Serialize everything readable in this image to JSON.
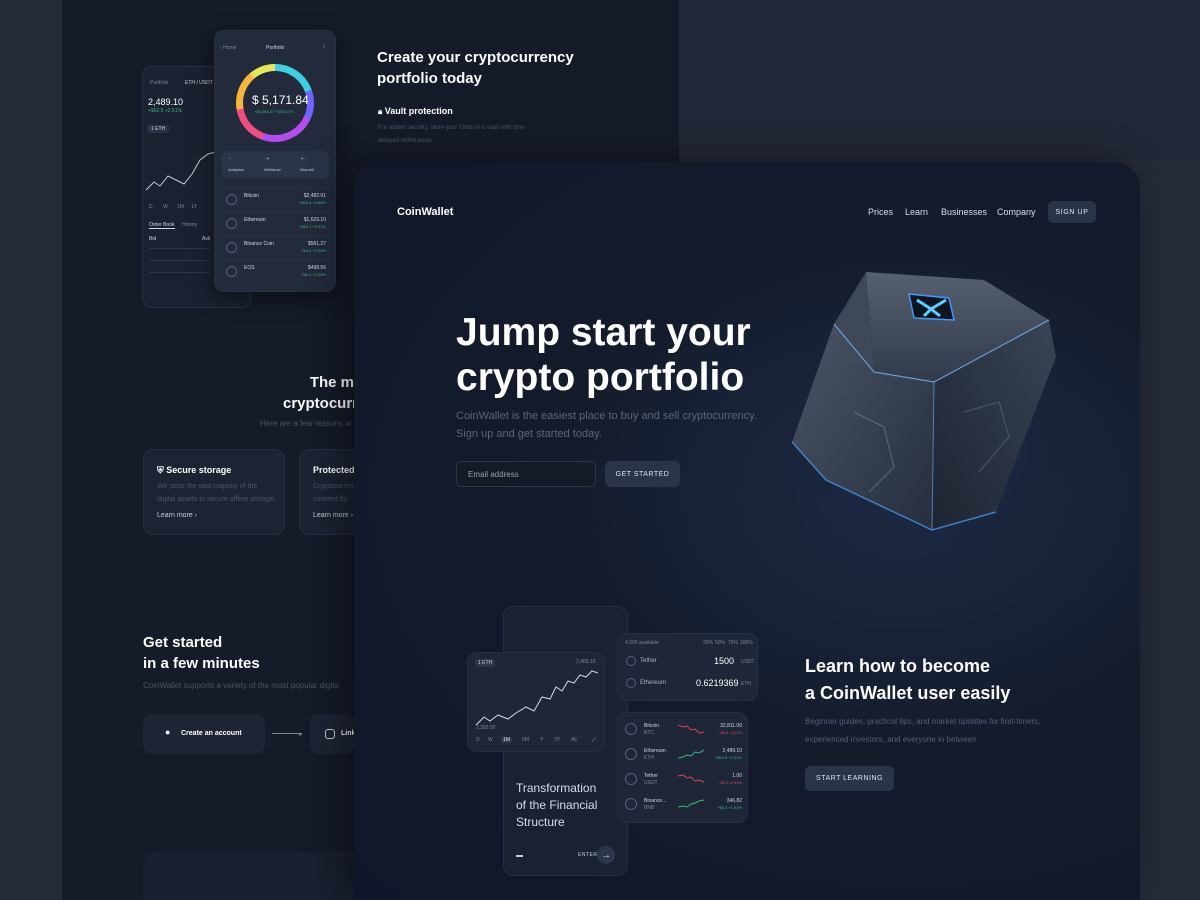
{
  "back": {
    "phone_back": {
      "nav": "Portfolio",
      "pair": "ETH / USDT",
      "price": "2,489.10",
      "change": "+$62.5  +2.51%",
      "badge": "1 ETH",
      "timeframes": [
        "D",
        "W",
        "1M",
        "1Y",
        "All"
      ],
      "tabs": [
        "Order Book",
        "History",
        "Info"
      ],
      "col_bid": "Bid",
      "col_ask": "Ask"
    },
    "phone_front": {
      "home": "Home",
      "title": "Portfolio",
      "balance": "$ 5,171.84",
      "balance_change": "+$3,384.37  +653.67%",
      "actions": [
        "Analytics",
        "Withdraw",
        "Deposit"
      ],
      "coins": [
        {
          "name": "Bitcoin",
          "ticker": "0.0457 BTC",
          "value": "$2,482.91",
          "change": "+$23.6  +3.86%"
        },
        {
          "name": "Ethereum",
          "ticker": "0.6219 ETH",
          "value": "$1,629.10",
          "change": "+$16.1  +3.31%"
        },
        {
          "name": "Binance Coin",
          "ticker": "1.51 BNB",
          "value": "$561.27",
          "change": "+$4.6  +3.06%"
        },
        {
          "name": "EOS",
          "ticker": "127.4 EOS",
          "value": "$498.56",
          "change": "+$1.4  +2.36%"
        }
      ]
    },
    "create_title_line1": "Create your cryptocurrency",
    "create_title_line2": "portfolio today",
    "vault_title": "Vault protection",
    "vault_text_line1": "For added security, store your funds in a vault with time",
    "vault_text_line2": "delayed withdrawals.",
    "most_title_line1": "The m",
    "most_title_line2": "cryptocurr",
    "most_sub": "Here are a few reasons w",
    "features": [
      {
        "title": "Secure storage",
        "text": "We store the vast majority of the digital assets in secure offline storage.",
        "link": "Learn more"
      },
      {
        "title": "Protected",
        "text": "Cryptocurren is covered by",
        "link": "Learn more"
      }
    ],
    "started_title_line1": "Get started",
    "started_title_line2": "in a few minutes",
    "started_sub": "CoinWallet supports a variety of the most popular digita",
    "step1": "Create an account",
    "step2": "Link"
  },
  "front": {
    "brand": "CoinWallet",
    "nav": [
      "Prices",
      "Learn",
      "Businesses",
      "Company"
    ],
    "signup": "SIGN UP",
    "hero_line1": "Jump start your",
    "hero_line2": "crypto portfolio",
    "hero_sub": "CoinWallet is the easiest place to buy and sell cryptocurrency. Sign up and get started today.",
    "email_placeholder": "Email address",
    "cta": "GET STARTED",
    "learn_line1": "Learn how to become",
    "learn_line2": "a CoinWallet user easily",
    "learn_sub": "Beginner guides, practical tips, and market updates for first-timers, experienced investors, and everyone in between",
    "learn_cta": "START LEARNING",
    "transform_line1": "Transformation",
    "transform_line2": "of the Financial",
    "transform_line3": "Structure",
    "enter": "ENTER",
    "chart_card": {
      "badge": "1 ETH",
      "value": "2,489.10",
      "low": "2,392.00",
      "timeframes": [
        "D",
        "W",
        "1M",
        "6M",
        "Y",
        "3Y",
        "All"
      ]
    },
    "convert_card": {
      "label": "4,000 available",
      "pcts": [
        "25%",
        "50%",
        "75%",
        "100%"
      ],
      "rows": [
        {
          "coin": "Tether",
          "amount": "1500",
          "unit": "USDT"
        },
        {
          "coin": "Ethereum",
          "amount": "0.6219369",
          "unit": "ETH"
        }
      ]
    },
    "list_card": [
      {
        "coin": "Bitcoin",
        "ticker": "BTC",
        "value": "32,811.00",
        "change": "-$6.5  -3.21%",
        "trend": "down"
      },
      {
        "coin": "Ethereum",
        "ticker": "ETH",
        "value": "2,489.10",
        "change": "+$62.5  +2.51%",
        "trend": "up"
      },
      {
        "coin": "Tether",
        "ticker": "USDT",
        "value": "1.00",
        "change": "-$0.0  -0.01%",
        "trend": "down"
      },
      {
        "coin": "Binance...",
        "ticker": "BNB",
        "value": "346.82",
        "change": "+$6.3  +1.92%",
        "trend": "up"
      }
    ]
  },
  "colors": {
    "bg": "#262b3a",
    "panel": "#151b29",
    "accent_cyan": "#3cd0e2",
    "positive": "#2fbf7a",
    "negative": "#e0425b",
    "button": "#2a3348"
  }
}
